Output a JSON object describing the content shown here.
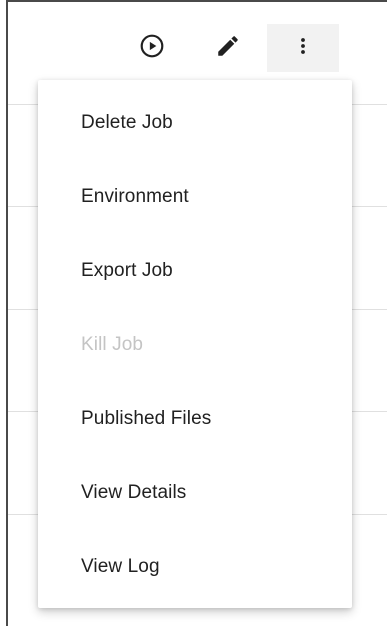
{
  "toolbar": {
    "run_icon": "play-circle-icon",
    "edit_icon": "pencil-icon",
    "more_icon": "more-vertical-icon"
  },
  "menu": {
    "items": [
      {
        "label": "Delete Job",
        "disabled": false
      },
      {
        "label": "Environment",
        "disabled": false
      },
      {
        "label": "Export Job",
        "disabled": false
      },
      {
        "label": "Kill Job",
        "disabled": true
      },
      {
        "label": "Published Files",
        "disabled": false
      },
      {
        "label": "View Details",
        "disabled": false
      },
      {
        "label": "View Log",
        "disabled": false
      }
    ]
  },
  "colors": {
    "text": "#212121",
    "disabled_text": "#c4c4c4",
    "active_button_bg": "#f2f2f2"
  }
}
